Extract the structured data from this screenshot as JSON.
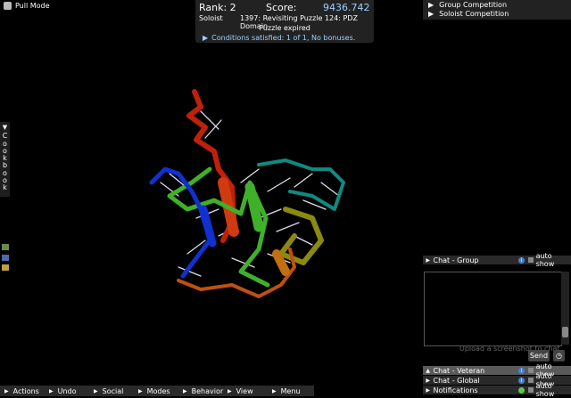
{
  "pull_mode": {
    "label": "Pull Mode",
    "icon": "pull-mode-icon"
  },
  "score_panel": {
    "rank": "Rank: 2",
    "score_label": "Score:",
    "score_value": "9436.742",
    "player": "Soloist",
    "puzzle": "1397: Revisiting Puzzle 124: PDZ Domain",
    "status": "Puzzle expired",
    "conditions": "Conditions satisfied: 1 of 1, No bonuses."
  },
  "competition": {
    "items": [
      {
        "label": "Group Competition"
      },
      {
        "label": "Soloist Competition"
      }
    ]
  },
  "cookbook": {
    "letters": [
      "C",
      "o",
      "o",
      "k",
      "b",
      "o",
      "o",
      "k"
    ]
  },
  "chat": {
    "tabs": [
      {
        "label": "Chat - Group",
        "auto": "auto show"
      },
      {
        "label": "Chat - Veteran",
        "auto": "auto show"
      },
      {
        "label": "Chat - Global",
        "auto": "auto show"
      },
      {
        "label": "Notifications",
        "auto": "auto show"
      }
    ],
    "upload_hint": "Upload a screenshot to chat.",
    "send_label": "Send"
  },
  "menu": {
    "items": [
      {
        "label": "Actions"
      },
      {
        "label": "Undo"
      },
      {
        "label": "Social"
      },
      {
        "label": "Modes"
      },
      {
        "label": "Behavior"
      },
      {
        "label": "View"
      },
      {
        "label": "Menu"
      }
    ]
  },
  "colors": {
    "accent_blue": "#9fd0ff",
    "protein_red": "#c0200a",
    "protein_green": "#3fb02a",
    "protein_blue": "#1030d0",
    "protein_teal": "#108a80",
    "protein_orange": "#c05010",
    "protein_olive": "#8a8a10"
  }
}
